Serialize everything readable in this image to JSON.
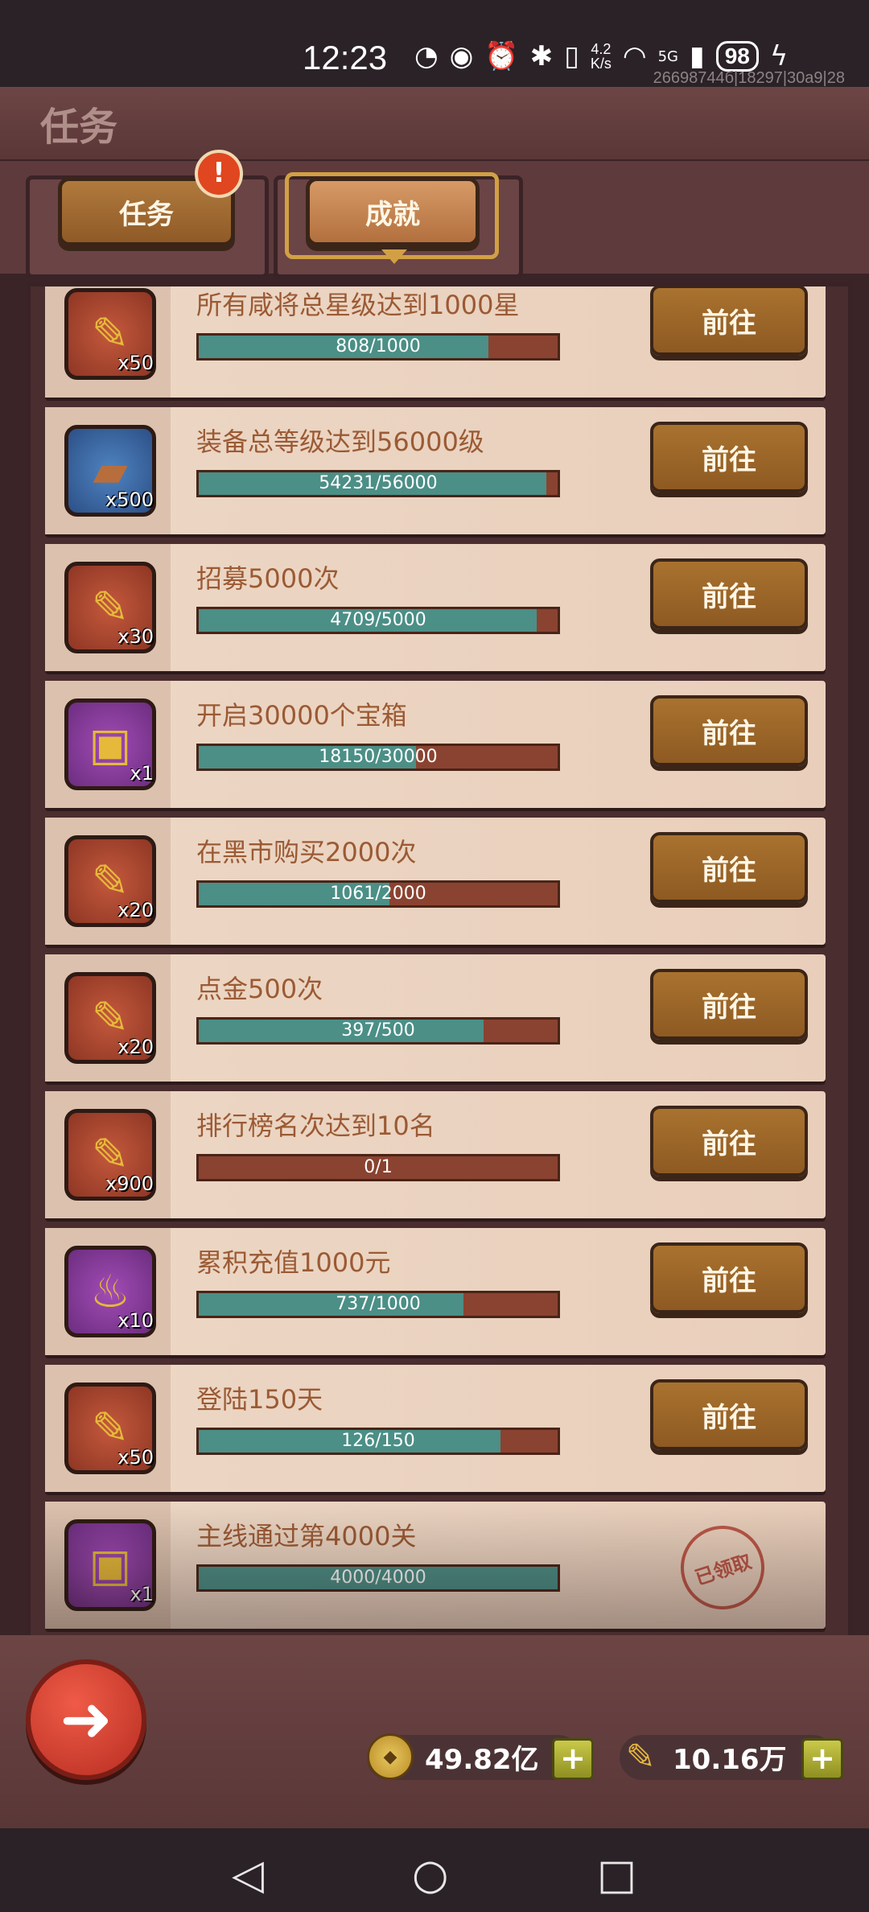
{
  "status_bar": {
    "time": "12:23",
    "speed_value": "4.2",
    "speed_unit": "K/s",
    "network": "5G",
    "battery": "98",
    "debug_text": "26698744б|18297|30a9|28"
  },
  "header": {
    "title": "任务"
  },
  "tabs": [
    {
      "label": "任务",
      "active": false,
      "badge": "!"
    },
    {
      "label": "成就",
      "active": true
    }
  ],
  "achievements": [
    {
      "title": "所有咸将总星级达到1000星",
      "icon": "gold-scroll-icon",
      "icon_bg": "red",
      "count": "x50",
      "current": 808,
      "target": 1000,
      "progress_text": "808/1000",
      "action": "前往"
    },
    {
      "title": "装备总等级达到56000级",
      "icon": "equipment-plate-icon",
      "icon_bg": "blue",
      "count": "x500",
      "current": 54231,
      "target": 56000,
      "progress_text": "54231/56000",
      "action": "前往"
    },
    {
      "title": "招募5000次",
      "icon": "gold-scroll-icon",
      "icon_bg": "red",
      "count": "x30",
      "current": 4709,
      "target": 5000,
      "progress_text": "4709/5000",
      "action": "前往"
    },
    {
      "title": "开启30000个宝箱",
      "icon": "treasure-chest-icon",
      "icon_bg": "purple",
      "count": "x1",
      "current": 18150,
      "target": 30000,
      "progress_text": "18150/30000",
      "action": "前往"
    },
    {
      "title": "在黑市购买2000次",
      "icon": "gold-scroll-icon",
      "icon_bg": "red",
      "count": "x20",
      "current": 1061,
      "target": 2000,
      "progress_text": "1061/2000",
      "action": "前往"
    },
    {
      "title": "点金500次",
      "icon": "gold-scroll-icon",
      "icon_bg": "red",
      "count": "x20",
      "current": 397,
      "target": 500,
      "progress_text": "397/500",
      "action": "前往"
    },
    {
      "title": "排行榜名次达到10名",
      "icon": "gold-scroll-icon",
      "icon_bg": "red",
      "count": "x900",
      "current": 0,
      "target": 1,
      "progress_text": "0/1",
      "action": "前往"
    },
    {
      "title": "累积充值1000元",
      "icon": "flame-torch-icon",
      "icon_bg": "purple",
      "count": "x10",
      "current": 737,
      "target": 1000,
      "progress_text": "737/1000",
      "action": "前往"
    },
    {
      "title": "登陆150天",
      "icon": "gold-scroll-icon",
      "icon_bg": "red",
      "count": "x50",
      "current": 126,
      "target": 150,
      "progress_text": "126/150",
      "action": "前往"
    },
    {
      "title": "主线通过第4000关",
      "icon": "treasure-chest-icon",
      "icon_bg": "purple",
      "count": "x1",
      "current": 4000,
      "target": 4000,
      "progress_text": "4000/4000",
      "claimed": true,
      "claimed_label": "已领取"
    }
  ],
  "resources": [
    {
      "icon": "coin-icon",
      "value": "49.82亿",
      "plus": "+"
    },
    {
      "icon": "gold-scroll-icon",
      "value": "10.16万",
      "plus": "+"
    }
  ],
  "colors": {
    "progress_fill": "#4b8f86",
    "progress_bg": "#8a4330",
    "row_bg": "#ecd7c5",
    "title_text": "#9b5a34"
  }
}
